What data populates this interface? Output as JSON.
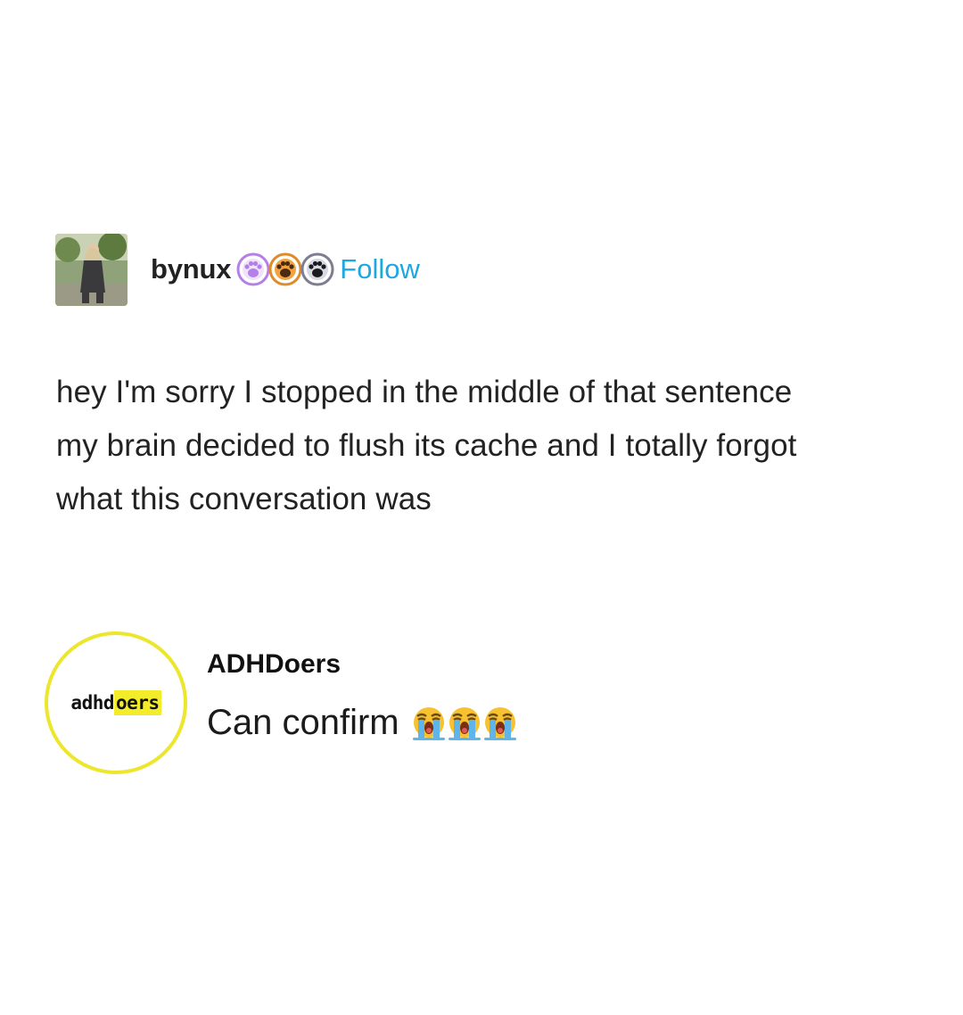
{
  "post": {
    "author": {
      "username": "bynux",
      "avatar_icon": "user-photo-avatar",
      "badges": [
        {
          "icon": "paw-badge-icon",
          "color": "#b67fe8"
        },
        {
          "icon": "paw-badge-icon",
          "color": "#e08a2a"
        },
        {
          "icon": "paw-badge-icon",
          "color": "#7d7d92"
        }
      ]
    },
    "follow_label": "Follow",
    "follow_color": "#1fa7e0",
    "body_lines": [
      "hey I'm sorry I stopped in the middle of that sentence",
      "my brain decided to flush its cache and I totally forgot",
      "what this conversation was"
    ]
  },
  "reply": {
    "author": "ADHDoers",
    "avatar_logo": {
      "part_a": "adhd",
      "part_b": "oers",
      "ring_color": "#ece62c"
    },
    "text": "Can confirm",
    "emojis": [
      "loudly-crying-face-icon",
      "loudly-crying-face-icon",
      "loudly-crying-face-icon"
    ]
  }
}
